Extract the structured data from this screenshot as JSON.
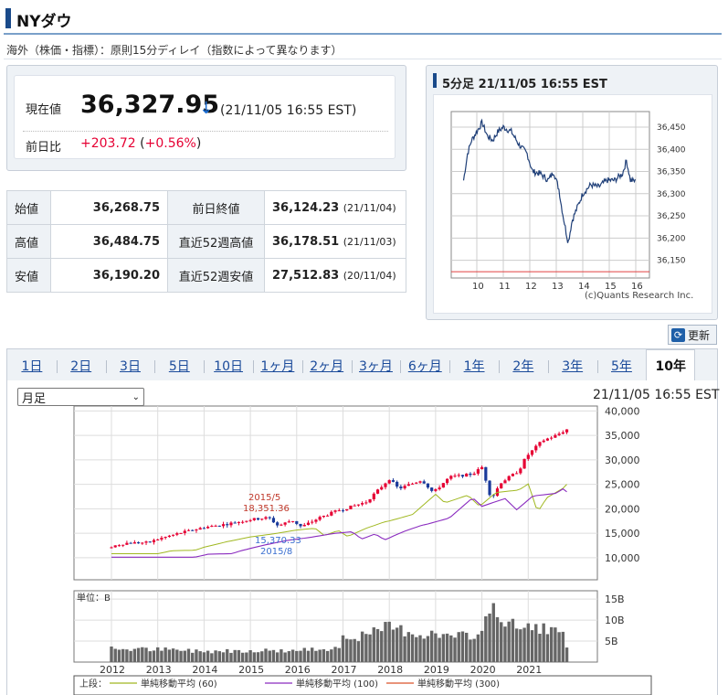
{
  "page": {
    "title": "NYダウ",
    "delay_note": "海外（株価・指標）：原則15分ディレイ（指数によって異なります）"
  },
  "quote": {
    "price_label": "現在値",
    "price": "36,327.95",
    "arrow": "↓",
    "time": "(21/11/05 16:55 EST)",
    "change_label": "前日比",
    "change": "+203.72",
    "change_pct_open": " (",
    "change_pct": "+0.56%",
    "change_pct_close": ")"
  },
  "stats": {
    "open_label": "始値",
    "open": "36,268.75",
    "high_label": "高値",
    "high": "36,484.75",
    "low_label": "安値",
    "low": "36,190.20",
    "prev_close_label": "前日終値",
    "prev_close": "36,124.23",
    "prev_close_date": "(21/11/04)",
    "high52_label": "直近52週高値",
    "high52": "36,178.51",
    "high52_date": "(21/11/03)",
    "low52_label": "直近52週安値",
    "low52": "27,512.83",
    "low52_date": "(20/11/04)"
  },
  "intraday": {
    "title": "5分足 21/11/05 16:55 EST",
    "credit": "(c)Quants Research Inc.",
    "y_ticks": [
      "36,450",
      "36,400",
      "36,350",
      "36,300",
      "36,250",
      "36,200",
      "36,150"
    ],
    "x_ticks": [
      "10",
      "11",
      "12",
      "13",
      "14",
      "15",
      "16"
    ]
  },
  "refresh_label": "更新",
  "tabs": [
    "1日",
    "2日",
    "3日",
    "5日",
    "10日",
    "1ヶ月",
    "2ヶ月",
    "3ヶ月",
    "6ヶ月",
    "1年",
    "2年",
    "3年",
    "5年",
    "10年"
  ],
  "active_tab": "10年",
  "period_select": "月足",
  "chart_time": "21/11/05 16:55 EST",
  "chart_data": {
    "type": "candlestick",
    "y_ticks": [
      "40,000",
      "35,000",
      "30,000",
      "25,000",
      "20,000",
      "15,000",
      "10,000"
    ],
    "ylim": [
      5500,
      41000
    ],
    "x_ticks": [
      "2012",
      "2013",
      "2014",
      "2015",
      "2016",
      "2017",
      "2018",
      "2019",
      "2020",
      "2021"
    ],
    "annotations": [
      {
        "date": "2015/5",
        "value": "18,351.36",
        "color": "#c0392b"
      },
      {
        "date": "2015/8",
        "value": "15,370.33",
        "color": "#3a6fd0"
      }
    ],
    "volume_label": "単位：B",
    "volume_ticks": [
      "15B",
      "10B",
      "5B"
    ],
    "legend_prefix": "上段：",
    "legend": [
      {
        "name": "単純移動平均 (60)",
        "color": "#a0b820"
      },
      {
        "name": "単純移動平均 (100)",
        "color": "#8a2bbf"
      },
      {
        "name": "単純移動平均 (300)",
        "color": "#d9532b"
      }
    ],
    "monthly_close_anchors": [
      [
        2012.0,
        12300
      ],
      [
        2012.3,
        13000
      ],
      [
        2012.8,
        13100
      ],
      [
        2013.0,
        13800
      ],
      [
        2013.5,
        15100
      ],
      [
        2014.0,
        16200
      ],
      [
        2014.5,
        16900
      ],
      [
        2015.0,
        17800
      ],
      [
        2015.4,
        18200
      ],
      [
        2015.6,
        16500
      ],
      [
        2015.9,
        17700
      ],
      [
        2016.1,
        16300
      ],
      [
        2016.5,
        18200
      ],
      [
        2016.9,
        19700
      ],
      [
        2017.0,
        19900
      ],
      [
        2017.5,
        21400
      ],
      [
        2018.0,
        26100
      ],
      [
        2018.2,
        24100
      ],
      [
        2018.7,
        25900
      ],
      [
        2018.95,
        23300
      ],
      [
        2019.3,
        26500
      ],
      [
        2019.8,
        27100
      ],
      [
        2020.0,
        28500
      ],
      [
        2020.1,
        25400
      ],
      [
        2020.2,
        21900
      ],
      [
        2020.4,
        25300
      ],
      [
        2020.8,
        27800
      ],
      [
        2020.95,
        30600
      ],
      [
        2021.3,
        33900
      ],
      [
        2021.6,
        35000
      ],
      [
        2021.85,
        36300
      ]
    ],
    "volume_anchors": [
      [
        2012.0,
        3.2
      ],
      [
        2013.0,
        3.0
      ],
      [
        2014.0,
        2.6
      ],
      [
        2015.0,
        2.8
      ],
      [
        2016.0,
        2.7
      ],
      [
        2016.9,
        3.5
      ],
      [
        2017.0,
        6.0
      ],
      [
        2017.5,
        6.2
      ],
      [
        2018.0,
        8.5
      ],
      [
        2018.5,
        7.0
      ],
      [
        2019.0,
        6.5
      ],
      [
        2019.5,
        6.0
      ],
      [
        2020.0,
        6.8
      ],
      [
        2020.2,
        15.0
      ],
      [
        2020.4,
        10.0
      ],
      [
        2020.8,
        8.0
      ],
      [
        2021.2,
        8.5
      ],
      [
        2021.8,
        6.5
      ],
      [
        2021.85,
        1.2
      ]
    ]
  }
}
